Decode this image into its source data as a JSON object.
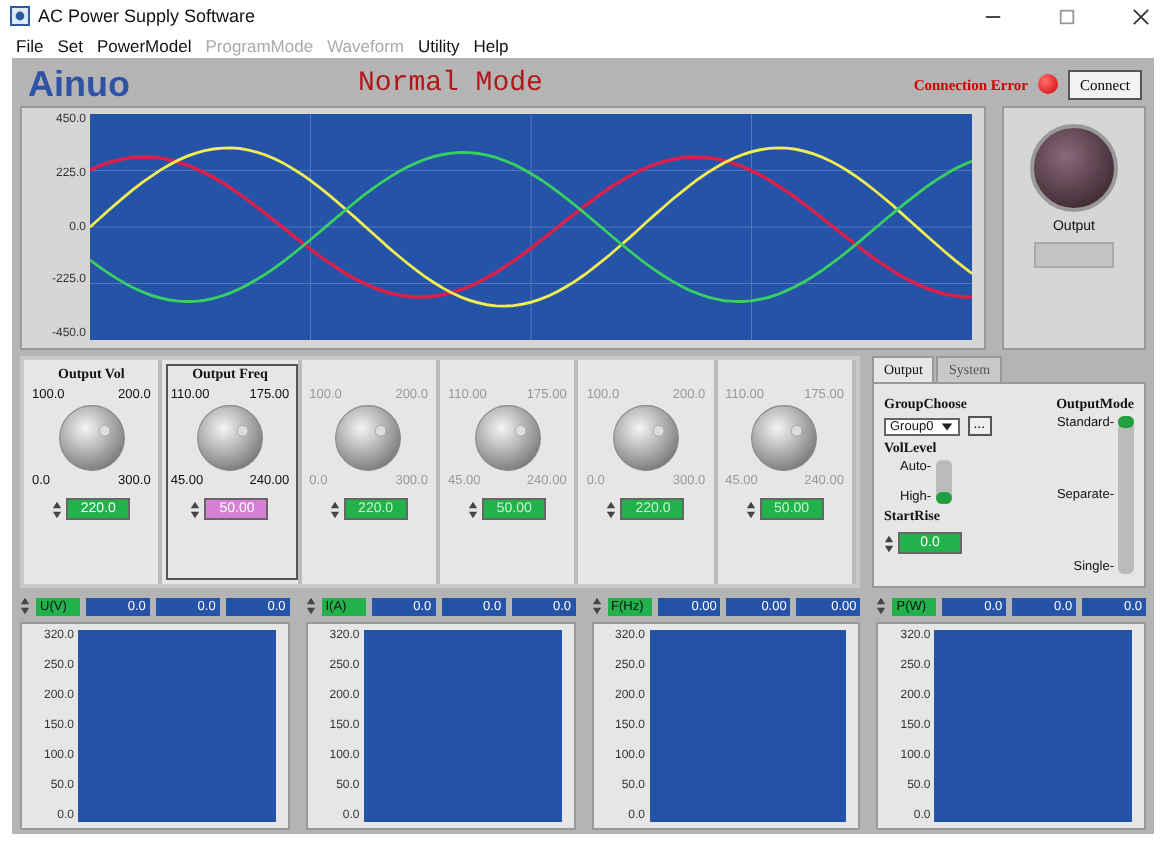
{
  "window": {
    "title": "AC Power Supply Software"
  },
  "menu": [
    {
      "label": "File",
      "disabled": false
    },
    {
      "label": "Set",
      "disabled": false
    },
    {
      "label": "PowerModel",
      "disabled": false
    },
    {
      "label": "ProgramMode",
      "disabled": true
    },
    {
      "label": "Waveform",
      "disabled": true
    },
    {
      "label": "Utility",
      "disabled": false
    },
    {
      "label": "Help",
      "disabled": false
    }
  ],
  "header": {
    "logo": "Ainuo",
    "mode": "Normal Mode",
    "connection_status": "Connection Error",
    "connect_button": "Connect"
  },
  "waveform": {
    "y_labels": [
      "450.0",
      "225.0",
      "0.0",
      "-225.0",
      "-450.0"
    ]
  },
  "output_panel": {
    "label": "Output"
  },
  "knobs": [
    {
      "title": "Output Vol",
      "labels": [
        "100.0",
        "200.0",
        "0.0",
        "300.0"
      ],
      "value": "220.0",
      "color": "#22b24c",
      "disabled": false,
      "selected": false
    },
    {
      "title": "Output Freq",
      "labels": [
        "110.00",
        "175.00",
        "45.00",
        "240.00"
      ],
      "value": "50.00",
      "color": "#d680d6",
      "disabled": false,
      "selected": true
    },
    {
      "labels": [
        "100.0",
        "200.0",
        "0.0",
        "300.0"
      ],
      "value": "220.0",
      "color": "#22b24c",
      "disabled": true,
      "selected": false
    },
    {
      "labels": [
        "110.00",
        "175.00",
        "45.00",
        "240.00"
      ],
      "value": "50.00",
      "color": "#22b24c",
      "disabled": true,
      "selected": false
    },
    {
      "labels": [
        "100.0",
        "200.0",
        "0.0",
        "300.0"
      ],
      "value": "220.0",
      "color": "#22b24c",
      "disabled": true,
      "selected": false
    },
    {
      "labels": [
        "110.00",
        "175.00",
        "45.00",
        "240.00"
      ],
      "value": "50.00",
      "color": "#22b24c",
      "disabled": true,
      "selected": false
    }
  ],
  "settings": {
    "tabs": [
      {
        "label": "Output",
        "selected": true
      },
      {
        "label": "System",
        "selected": false
      }
    ],
    "group_choose": {
      "label": "GroupChoose",
      "value": "Group0",
      "more_button": "..."
    },
    "vol_level": {
      "label": "VolLevel",
      "options": [
        "Auto-",
        "High-"
      ],
      "level": 0
    },
    "start_rise": {
      "label": "StartRise",
      "value": "0.0"
    },
    "output_mode": {
      "label": "OutputMode",
      "options": [
        "Standard-",
        "Separate-",
        "Single-"
      ],
      "level": 1
    }
  },
  "meters": [
    {
      "label": "U(V)",
      "readings": [
        "0.0",
        "0.0",
        "0.0"
      ],
      "y_labels": [
        "320.0",
        "250.0",
        "200.0",
        "150.0",
        "100.0",
        "50.0",
        "0.0"
      ]
    },
    {
      "label": "I(A)",
      "readings": [
        "0.0",
        "0.0",
        "0.0"
      ],
      "y_labels": [
        "320.0",
        "250.0",
        "200.0",
        "150.0",
        "100.0",
        "50.0",
        "0.0"
      ]
    },
    {
      "label": "F(Hz)",
      "readings": [
        "0.00",
        "0.00",
        "0.00"
      ],
      "y_labels": [
        "320.0",
        "250.0",
        "200.0",
        "150.0",
        "100.0",
        "50.0",
        "0.0"
      ]
    },
    {
      "label": "P(W)",
      "readings": [
        "0.0",
        "0.0",
        "0.0"
      ],
      "y_labels": [
        "320.0",
        "250.0",
        "200.0",
        "150.0",
        "100.0",
        "50.0",
        "0.0"
      ]
    }
  ]
}
